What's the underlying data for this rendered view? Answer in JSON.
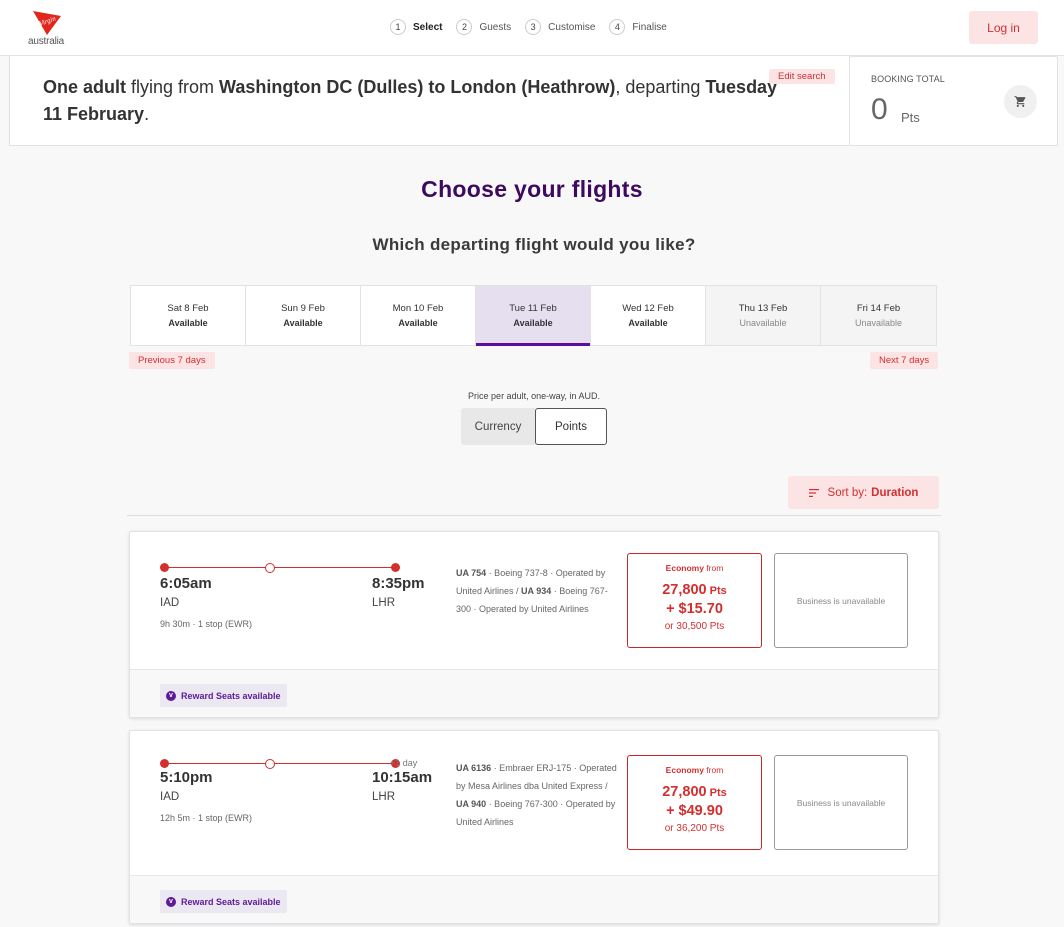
{
  "header": {
    "logo_text": "australia",
    "steps": [
      {
        "num": "1",
        "label": "Select"
      },
      {
        "num": "2",
        "label": "Guests"
      },
      {
        "num": "3",
        "label": "Customise"
      },
      {
        "num": "4",
        "label": "Finalise"
      }
    ],
    "active_step": 1,
    "login_label": "Log in"
  },
  "summary": {
    "passengers": "One adult",
    "text_flying_from": " flying from ",
    "route": "Washington DC (Dulles) to London (Heathrow)",
    "text_departing": ", departing ",
    "date": "Tuesday 11 February",
    "end": ".",
    "edit_label": "Edit search"
  },
  "booking_total": {
    "label": "BOOKING TOTAL",
    "value": "0",
    "unit": "Pts"
  },
  "main": {
    "title": "Choose your flights",
    "subtitle": "Which departing flight would you like?",
    "dates": [
      {
        "day": "Sat 8 Feb",
        "status": "Available"
      },
      {
        "day": "Sun 9 Feb",
        "status": "Available"
      },
      {
        "day": "Mon 10 Feb",
        "status": "Available"
      },
      {
        "day": "Tue 11 Feb",
        "status": "Available"
      },
      {
        "day": "Wed 12 Feb",
        "status": "Available"
      },
      {
        "day": "Thu 13 Feb",
        "status": "Unavailable"
      },
      {
        "day": "Fri 14 Feb",
        "status": "Unavailable"
      }
    ],
    "selected_date_index": 3,
    "prev_label": "Previous 7 days",
    "next_label": "Next 7 days",
    "price_note": "Price per adult, one-way, in AUD.",
    "toggle": {
      "currency": "Currency",
      "points": "Points",
      "selected": "Points"
    },
    "sort": {
      "label": "Sort by:",
      "value": "Duration"
    }
  },
  "flights": [
    {
      "dep_time": "6:05am",
      "arr_time": "8:35pm",
      "dep_code": "IAD",
      "arr_code": "LHR",
      "plus_day": "",
      "duration": "9h 30m · 1 stop (EWR)",
      "info": {
        "seg1_flight": "UA 754",
        "seg1_details": " · Boeing 737-8 · Operated by United Airlines / ",
        "seg2_flight": "UA 934",
        "seg2_details": " · Boeing 767-300 · Operated by United Airlines"
      },
      "economy": {
        "class": "Economy",
        "from": " from",
        "points": "27,800",
        "pts_unit": " Pts",
        "cash": "+ $15.70",
        "alt": "or 30,500 Pts"
      },
      "business": "Business is unavailable",
      "reward_badge": "Reward Seats available"
    },
    {
      "dep_time": "5:10pm",
      "arr_time": "10:15am",
      "dep_code": "IAD",
      "arr_code": "LHR",
      "plus_day": "+1 day",
      "duration": "12h 5m · 1 stop (EWR)",
      "info": {
        "seg1_flight": "UA 6136",
        "seg1_details": " · Embraer ERJ-175 · Operated by Mesa Airlines dba United Express / ",
        "seg2_flight": "UA 940",
        "seg2_details": " · Boeing 767-300 · Operated by United Airlines"
      },
      "economy": {
        "class": "Economy",
        "from": " from",
        "points": "27,800",
        "pts_unit": " Pts",
        "cash": "+ $49.90",
        "alt": "or 36,200 Pts"
      },
      "business": "Business is unavailable",
      "reward_badge": "Reward Seats available"
    }
  ],
  "colors": {
    "brand_red": "#d32f2f",
    "brand_purple": "#3d0a5e",
    "accent_purple": "#5b0fa0"
  }
}
